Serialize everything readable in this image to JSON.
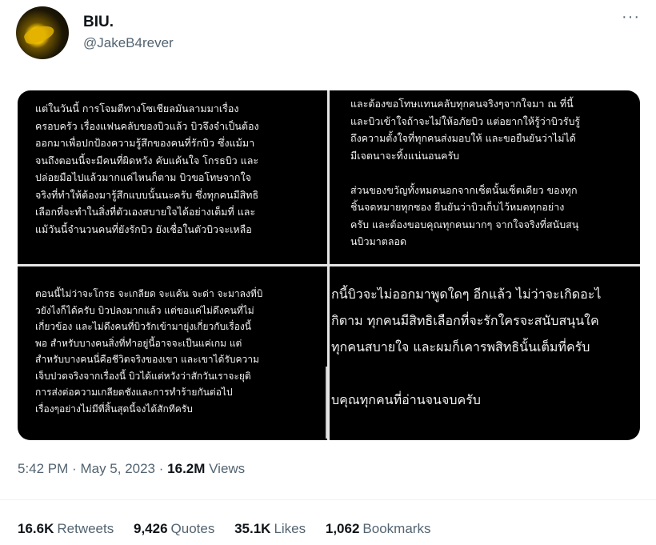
{
  "author": {
    "display_name": "BIU.",
    "handle": "@JakeB4rever",
    "avatar_icon": "avatar-image"
  },
  "more_icon": "more-horizontal-icon",
  "more_glyph": "···",
  "media": {
    "panel1": "แต่ในวันนี้ การโจมตีทางโซเชียลมันลามมาเรื่อง\nครอบครัว เรื่องแฟนคลับของบิวแล้ว บิวจึงจำเป็นต้อง\nออกมาเพื่อปกป้องความรู้สึกของคนที่รักบิว ซึ่งแม้มา\nจนถึงตอนนี้จะมีคนที่ผิดหวัง คับแค้นใจ โกรธบิว และ\nปล่อยมือไปแล้วมากแค่ไหนก็ตาม บิวขอโทษจากใจ\nจริงที่ทำให้ต้องมารู้สึกแบบนั้นนะครับ ซึ่งทุกคนมีสิทธิ\nเลือกที่จะทำในสิ่งที่ตัวเองสบายใจได้อย่างเต็มที่ และ\nแม้วันนี้จำนวนคนที่ยังรักบิว ยังเชื่อในตัวบิวจะเหลือ",
    "panel2": "และต้องขอโทษแทนคลับทุกคนจริงๆจากใจมา ณ ที่นี้\nและบิวเข้าใจถ้าจะไม่ให้อภัยบิว แต่อยากให้รู้ว่าบิวรับรู้\nถึงความตั้งใจที่ทุกคนส่งมอบให้ และขอยืนยันว่าไม่ได้\nมีเจตนาจะทิ้งแน่นอนครับ\n\nส่วนของขวัญทั้งหมดนอกจากเซ็ตนั้นเซ็ตเดียว ของทุก\nชิ้นจดหมายทุกซอง ยืนยันว่าบิวเก็บไว้หมดทุกอย่าง\nครับ และต้องขอบคุณทุกคนมากๆ จากใจจริงที่สนับสนุ\nนบิวมาตลอด",
    "panel3": "ตอนนี้ไม่ว่าจะโกรธ จะเกลียด จะแค้น จะด่า จะมาลงที่บิ\nวยังไงก็ได้ครับ บิวปลงมากแล้ว แต่ขอแค่ไม่ดึงคนที่ไม่\nเกี่ยวข้อง และไม่ดึงคนที่บิวรักเข้ามายุ่งเกี่ยวกับเรื่องนี้\nพอ สำหรับบางคนสิ่งที่ทำอยู่นี้อาจจะเป็นแค่เกม แต่\nสำหรับบางคนนี่คือชีวิตจริงของเขา และเขาได้รับความ\nเจ็บปวดจริงจากเรื่องนี้ บิวได้แต่หวังว่าสักวันเราจะยุติ\nการส่งต่อความเกลียดชังและการทำร้ายกันต่อไป\nเรื่องๆอย่างไม่มีที่สิ้นสุดนี้จงได้สักทีครับ",
    "panel4": "กนี้บิวจะไม่ออกมาพูดใดๆ อีกแล้ว ไม่ว่าจะเกิดอะไ\nกิตาม ทุกคนมีสิทธิเลือกที่จะรักใครจะสนับสนุนใค\nทุกคนสบายใจ และผมก็เคารพสิทธินั้นเต็มที่ครับ\n\nบคุณทุกคนที่อ่านจนจบครับ"
  },
  "meta": {
    "time": "5:42 PM",
    "separator": "·",
    "date": "May 5, 2023",
    "views_count": "16.2M",
    "views_label": "Views"
  },
  "stats": {
    "retweets_count": "16.6K",
    "retweets_label": "Retweets",
    "quotes_count": "9,426",
    "quotes_label": "Quotes",
    "likes_count": "35.1K",
    "likes_label": "Likes",
    "bookmarks_count": "1,062",
    "bookmarks_label": "Bookmarks"
  },
  "colors": {
    "text_primary": "#0f1419",
    "text_secondary": "#536471",
    "divider": "#eff3f4",
    "media_bg": "#000000"
  }
}
